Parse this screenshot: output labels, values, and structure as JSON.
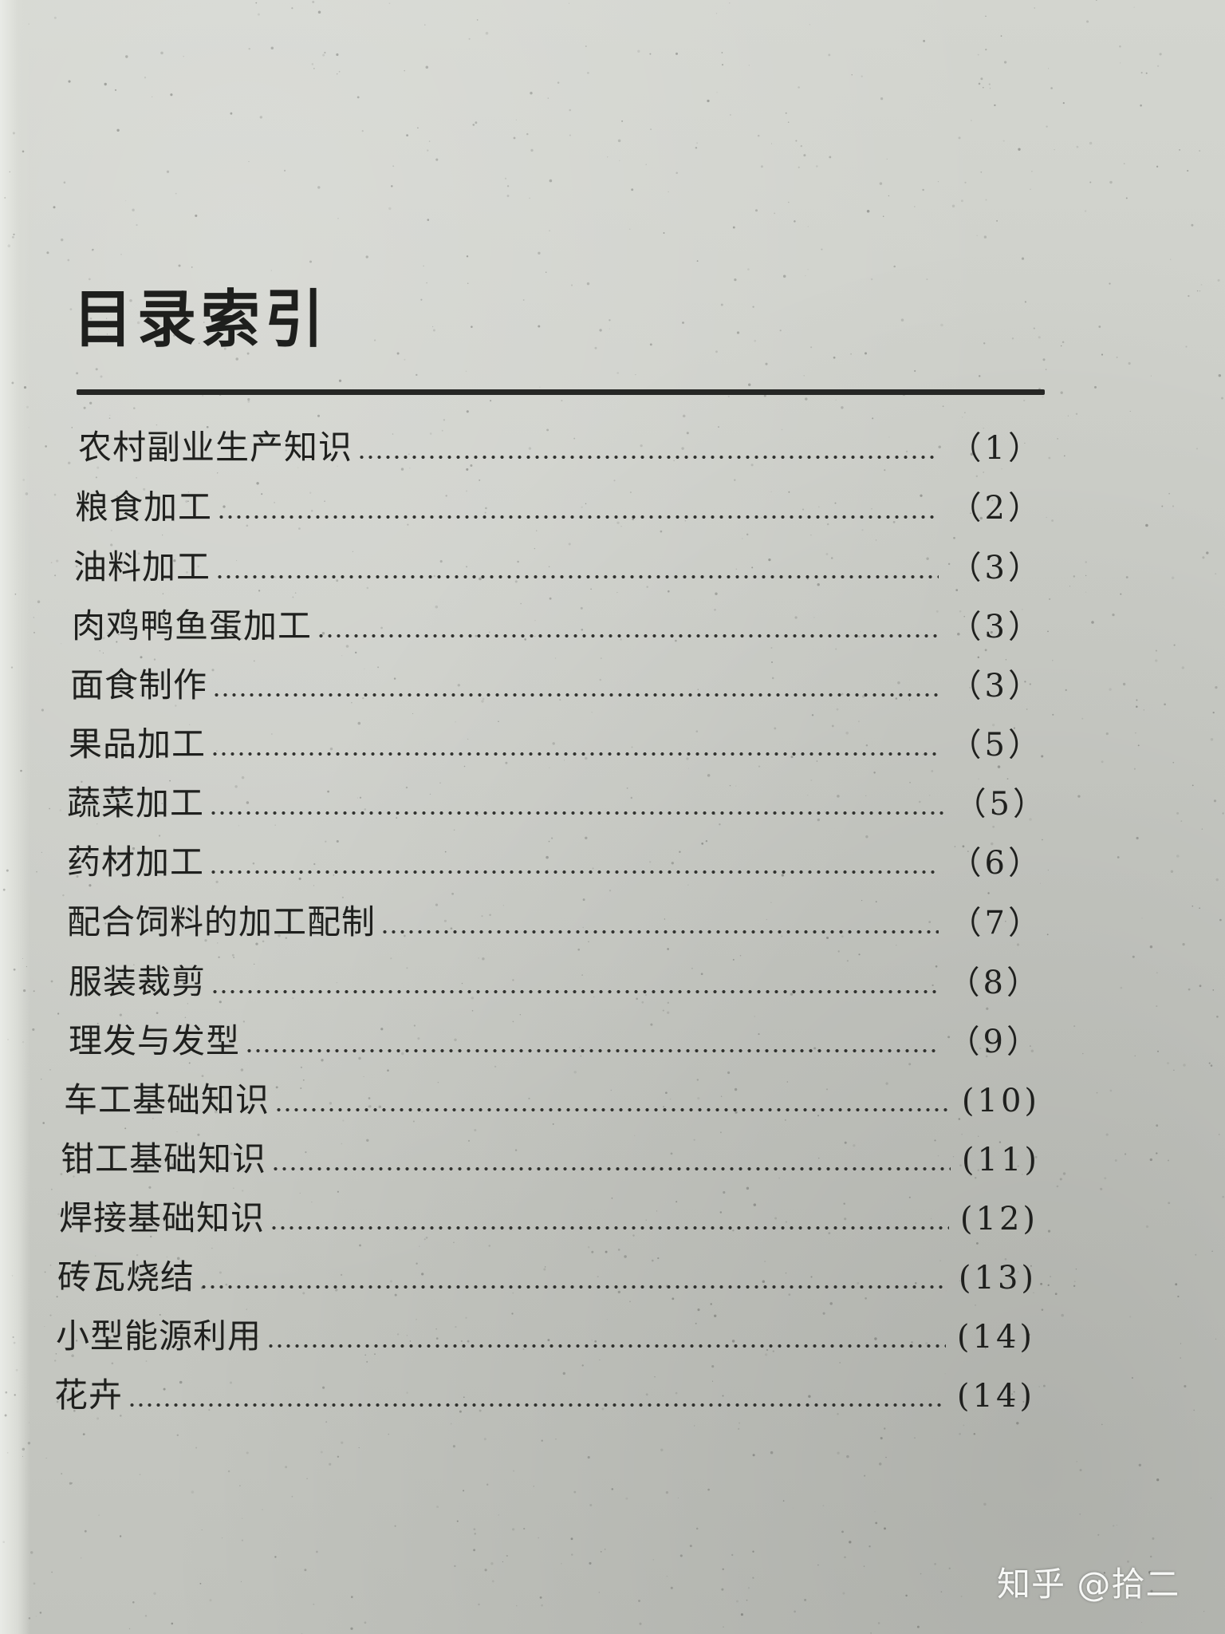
{
  "title": "目录索引",
  "entries": [
    {
      "label": "农村副业生产知识",
      "page": "（1）"
    },
    {
      "label": "粮食加工",
      "page": "（2）"
    },
    {
      "label": "油料加工",
      "page": "（3）"
    },
    {
      "label": "肉鸡鸭鱼蛋加工",
      "page": "（3）"
    },
    {
      "label": "面食制作",
      "page": "（3）"
    },
    {
      "label": "果品加工",
      "page": "（5）"
    },
    {
      "label": "蔬菜加工",
      "page": "（5）"
    },
    {
      "label": "药材加工",
      "page": "（6）"
    },
    {
      "label": "配合饲料的加工配制",
      "page": "（7）"
    },
    {
      "label": "服装裁剪",
      "page": "（8）"
    },
    {
      "label": "理发与发型",
      "page": "（9）"
    },
    {
      "label": "车工基础知识",
      "page": "(10)"
    },
    {
      "label": "钳工基础知识",
      "page": "(11)"
    },
    {
      "label": "焊接基础知识",
      "page": "(12)"
    },
    {
      "label": "砖瓦烧结",
      "page": "(13)"
    },
    {
      "label": "小型能源利用",
      "page": "(14)"
    },
    {
      "label": "花卉",
      "page": "(14)"
    }
  ],
  "watermark": "知乎 @拾二"
}
